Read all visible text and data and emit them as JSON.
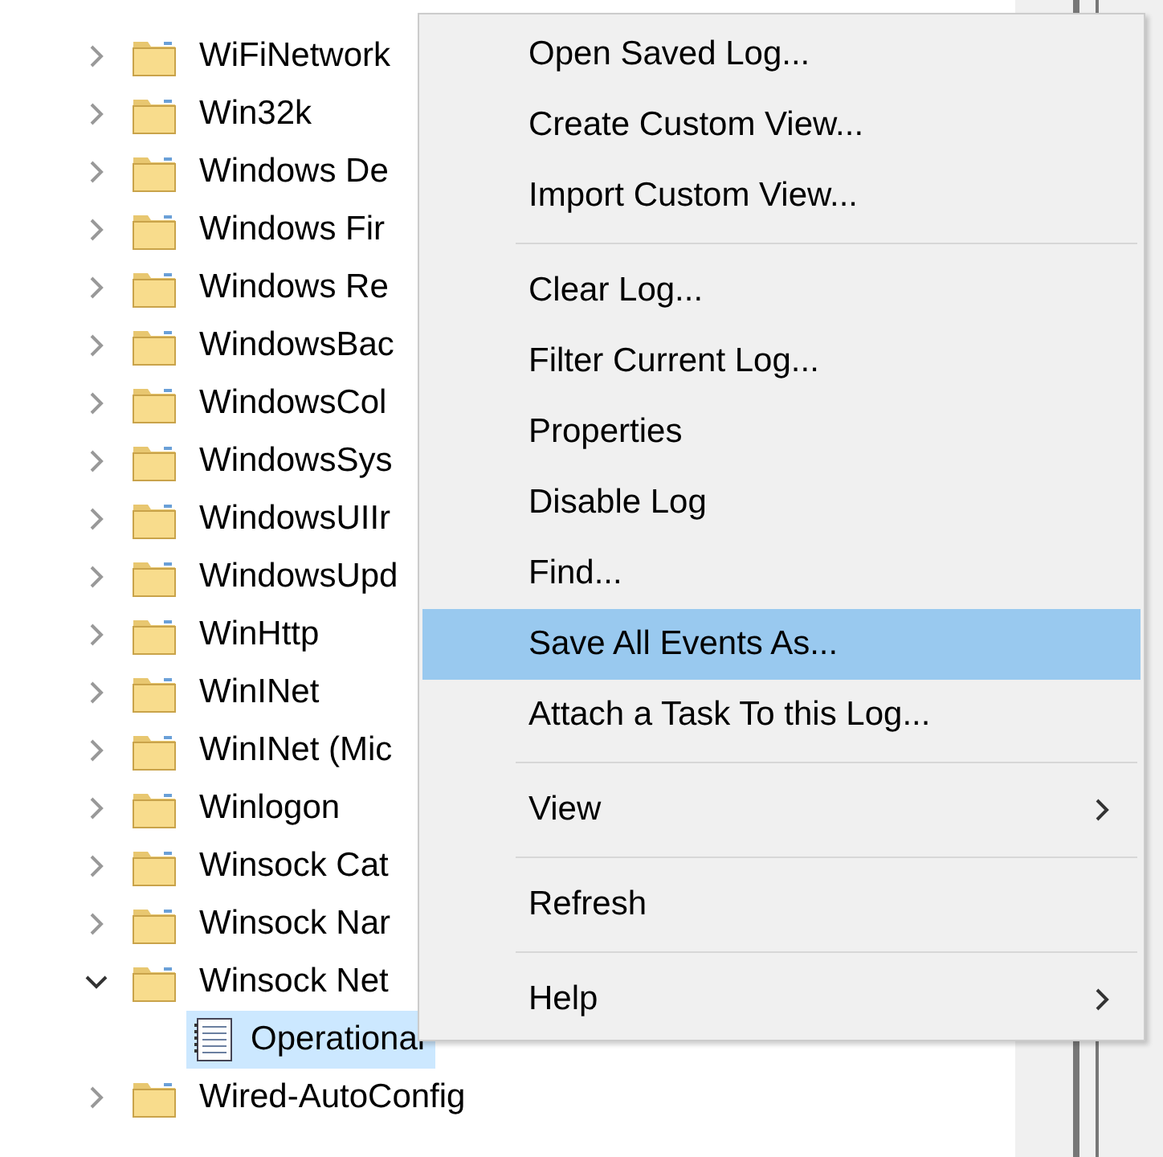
{
  "tree": {
    "items": [
      {
        "label": "WiFiNetwork",
        "expanded": false,
        "selected": false
      },
      {
        "label": "Win32k",
        "expanded": false,
        "selected": false
      },
      {
        "label": "Windows De",
        "expanded": false,
        "selected": false
      },
      {
        "label": "Windows Fir",
        "expanded": false,
        "selected": false
      },
      {
        "label": "Windows Re",
        "expanded": false,
        "selected": false
      },
      {
        "label": "WindowsBac",
        "expanded": false,
        "selected": false
      },
      {
        "label": "WindowsCol",
        "expanded": false,
        "selected": false
      },
      {
        "label": "WindowsSys",
        "expanded": false,
        "selected": false
      },
      {
        "label": "WindowsUIIr",
        "expanded": false,
        "selected": false
      },
      {
        "label": "WindowsUpd",
        "expanded": false,
        "selected": false
      },
      {
        "label": "WinHttp",
        "expanded": false,
        "selected": false
      },
      {
        "label": "WinINet",
        "expanded": false,
        "selected": false
      },
      {
        "label": "WinINet (Mic",
        "expanded": false,
        "selected": false
      },
      {
        "label": "Winlogon",
        "expanded": false,
        "selected": false
      },
      {
        "label": "Winsock Cat",
        "expanded": false,
        "selected": false
      },
      {
        "label": "Winsock Nar",
        "expanded": false,
        "selected": false
      },
      {
        "label": "Winsock Net",
        "expanded": true,
        "selected": false,
        "children": [
          {
            "label": "Operational",
            "selected": true
          }
        ]
      },
      {
        "label": "Wired-AutoConfig",
        "expanded": false,
        "selected": false
      }
    ]
  },
  "context_menu": {
    "items": [
      {
        "kind": "item",
        "label": "Open Saved Log...",
        "selected": false,
        "submenu": false
      },
      {
        "kind": "item",
        "label": "Create Custom View...",
        "selected": false,
        "submenu": false
      },
      {
        "kind": "item",
        "label": "Import Custom View...",
        "selected": false,
        "submenu": false
      },
      {
        "kind": "separator"
      },
      {
        "kind": "item",
        "label": "Clear Log...",
        "selected": false,
        "submenu": false
      },
      {
        "kind": "item",
        "label": "Filter Current Log...",
        "selected": false,
        "submenu": false
      },
      {
        "kind": "item",
        "label": "Properties",
        "selected": false,
        "submenu": false
      },
      {
        "kind": "item",
        "label": "Disable Log",
        "selected": false,
        "submenu": false
      },
      {
        "kind": "item",
        "label": "Find...",
        "selected": false,
        "submenu": false
      },
      {
        "kind": "item",
        "label": "Save All Events As...",
        "selected": true,
        "submenu": false
      },
      {
        "kind": "item",
        "label": "Attach a Task To this Log...",
        "selected": false,
        "submenu": false
      },
      {
        "kind": "separator"
      },
      {
        "kind": "item",
        "label": "View",
        "selected": false,
        "submenu": true
      },
      {
        "kind": "separator"
      },
      {
        "kind": "item",
        "label": "Refresh",
        "selected": false,
        "submenu": false
      },
      {
        "kind": "separator"
      },
      {
        "kind": "item",
        "label": "Help",
        "selected": false,
        "submenu": true
      }
    ]
  }
}
